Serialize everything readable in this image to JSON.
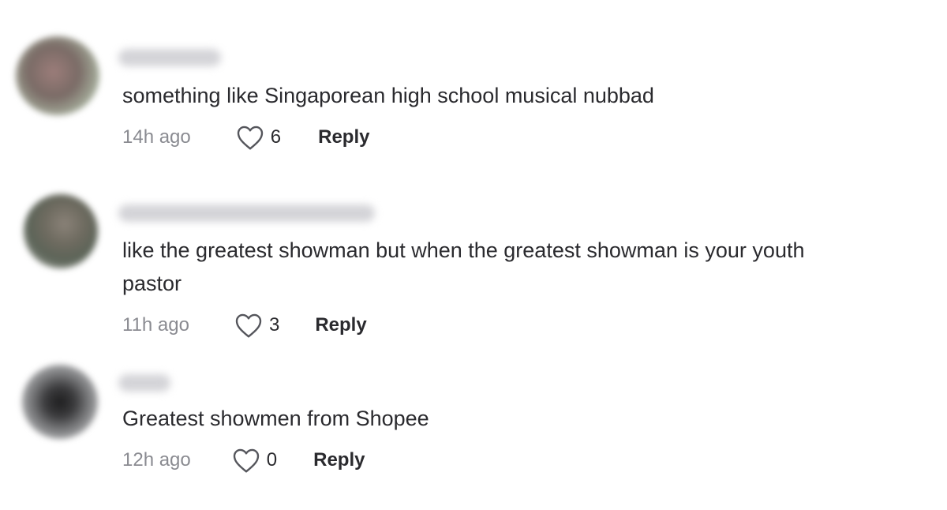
{
  "comments": [
    {
      "text": "something like Singaporean high school musical nubbad",
      "time": "14h ago",
      "likes": "6",
      "reply_label": "Reply"
    },
    {
      "text": "like the greatest showman but when the greatest showman is your youth\npastor",
      "time": "11h ago",
      "likes": "3",
      "reply_label": "Reply"
    },
    {
      "text": "Greatest showmen from Shopee",
      "time": "12h ago",
      "likes": "0",
      "reply_label": "Reply"
    }
  ],
  "icons": {
    "like": "heart-outline-icon"
  }
}
